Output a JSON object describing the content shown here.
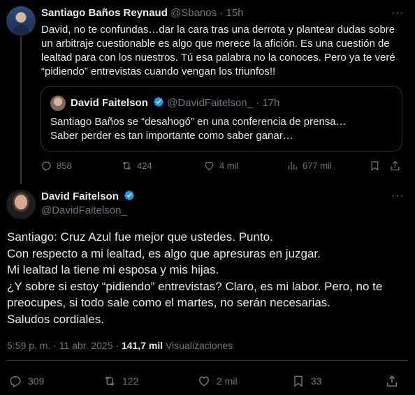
{
  "quoting_tweet": {
    "author_name": "Santiago Baños Reynaud",
    "handle": "@Sbanos",
    "separator": "·",
    "time": "15h",
    "more": "···",
    "text": "David, no te confundas…dar la cara tras una derrota y plantear dudas sobre un arbitraje cuestionable es algo que merece la afición. Es una cuestión de lealtad para con los nuestros. Tú esa palabra no la conoces. Pero ya te veré “pidiendo” entrevistas cuando vengan los triunfos!!",
    "quoted": {
      "author_name": "David Faitelson",
      "handle": "@DavidFaitelson_",
      "separator": "·",
      "time": "17h",
      "text_line1": "Santiago Baños se “desahogó” en una conferencia de prensa…",
      "text_line2": "Saber perder es tan importante como saber ganar…"
    },
    "actions": {
      "replies": "858",
      "reposts": "424",
      "likes": "4 mil",
      "views": "677 mil"
    }
  },
  "main_tweet": {
    "author_name": "David Faitelson",
    "handle": "@DavidFaitelson_",
    "more": "···",
    "lines": [
      "Santiago: Cruz Azul fue mejor que ustedes. Punto.",
      "Con respecto a mi lealtad, es algo que apresuras en juzgar.",
      "Mi lealtad la tiene mi esposa y mis hijas.",
      "¿Y sobre si estoy “pidiendo” entrevistas? Claro, es mi labor. Pero, no te",
      "preocupes, si todo sale como el martes, no serán necesarias.",
      "Saludos cordiales."
    ],
    "timestamp": "5:59 p. m. · 11 abr. 2025 ·",
    "views_count": "141,7 mil",
    "views_label": "Visualizaciones",
    "actions": {
      "replies": "309",
      "reposts": "122",
      "likes": "2 mil",
      "bookmarks": "33"
    }
  },
  "colors": {
    "background": "#000000",
    "text": "#e7e9ea",
    "muted": "#71767b",
    "border": "#2f3336",
    "verified": "#1d9bf0"
  }
}
